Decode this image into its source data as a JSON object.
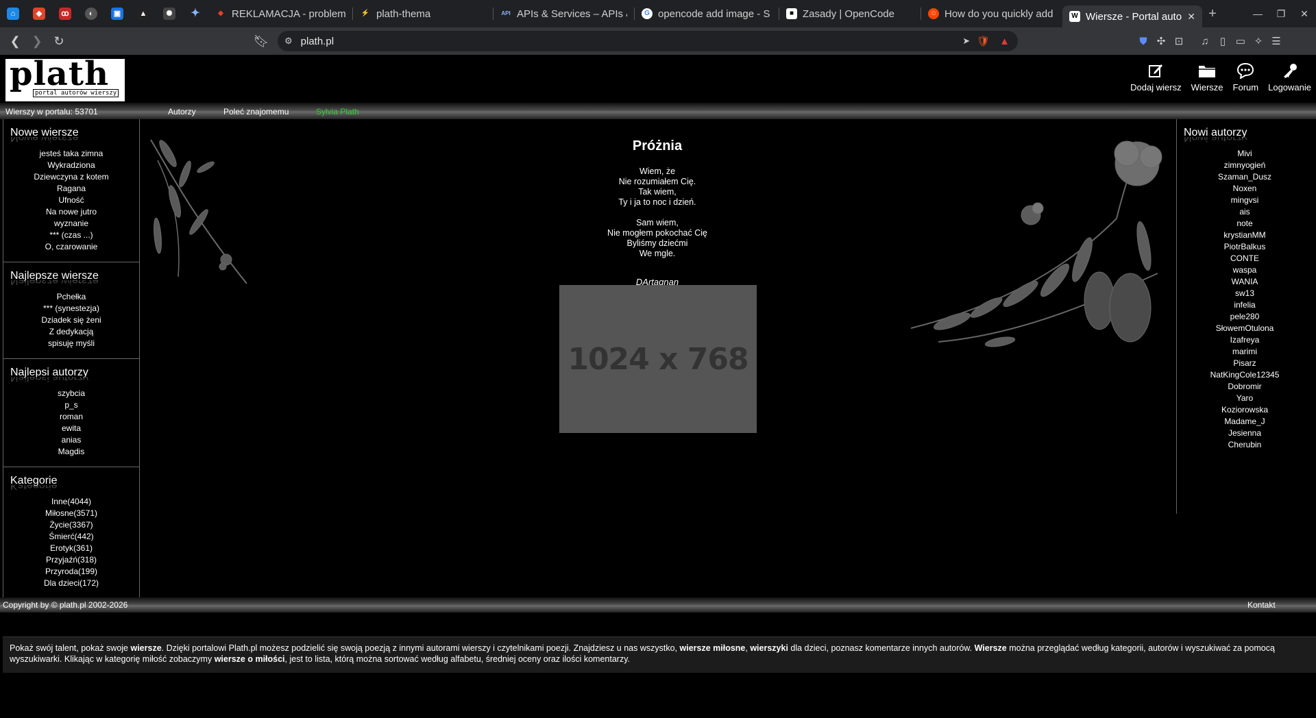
{
  "browser": {
    "tabs": [
      {
        "title": "REKLAMACJA - problem",
        "fav": "gitlab"
      },
      {
        "title": "plath-thema",
        "fav": "figma"
      },
      {
        "title": "APIs & Services – APIs &",
        "fav": "api"
      },
      {
        "title": "opencode add image - S",
        "fav": "google"
      },
      {
        "title": "Zasady | OpenCode",
        "fav": "opencode"
      },
      {
        "title": "How do you quickly add",
        "fav": "reddit"
      },
      {
        "title": "Wiersze - Portal auto",
        "fav": "plath",
        "active": true
      }
    ],
    "address": "plath.pl"
  },
  "site": {
    "logo_big": "plath",
    "logo_small": "portal autorów wierszy",
    "topnav": [
      {
        "label": "Dodaj wiersz",
        "icon": "edit-icon"
      },
      {
        "label": "Wiersze",
        "icon": "folder-icon"
      },
      {
        "label": "Forum",
        "icon": "chat-icon"
      },
      {
        "label": "Logowanie",
        "icon": "key-icon"
      }
    ],
    "subnav": {
      "count": "Wierszy w portalu: 53701",
      "authors": "Autorzy",
      "recommend": "Poleć znajomemu",
      "featured": "Sylvia Plath"
    },
    "new_poems": {
      "title": "Nowe wiersze",
      "items": [
        "jesteś taka zimna",
        "Wykradziona",
        "Dziewczyna z kotem",
        "Ragana",
        "Ufność",
        "Na nowe jutro",
        "wyznanie",
        "*** (czas ...)",
        "O, czarowanie"
      ]
    },
    "best_poems": {
      "title": "Najlepsze wiersze",
      "items": [
        "Pchełka",
        "*** (synestezja)",
        "Dziadek się żeni",
        "Z dedykacją",
        "spisuję myśli"
      ]
    },
    "best_authors": {
      "title": "Najlepsi autorzy",
      "items": [
        "szybcia",
        "p_s",
        "roman",
        "ewita",
        "anias",
        "Magdis"
      ]
    },
    "categories": {
      "title": "Kategorie",
      "items": [
        "Inne(4044)",
        "Miłosne(3571)",
        "Życie(3367)",
        "Śmierć(442)",
        "Erotyk(361)",
        "Przyjaźń(318)",
        "Przyroda(199)",
        "Dla dzieci(172)"
      ]
    },
    "poem": {
      "title": "Próżnia",
      "stanza1": [
        "Wiem, że",
        "Nie rozumiałem Cię.",
        "Tak wiem,",
        "Ty i ja to noc i dzień."
      ],
      "stanza2": [
        "Sam wiem,",
        "Nie mogłem pokochać Cię",
        "Byliśmy dziećmi",
        "We mgle."
      ],
      "author": "DArtagnan",
      "image_placeholder": "1024 x 768"
    },
    "new_authors": {
      "title": "Nowi autorzy",
      "items": [
        "Mivi",
        "zimnyogień",
        "Szaman_Dusz",
        "Noxen",
        "mingvsi",
        "ais",
        "note",
        "krystianMM",
        "PiotrBalkus",
        "CONTE",
        "waspa",
        "WANIA",
        "sw13",
        "infelia",
        "pele280",
        "SłowemOtulona",
        "Izafreya",
        "marimi",
        "Pisarz",
        "NatKingCole12345",
        "Dobromir",
        "Yaro",
        "Koziorowska",
        "Madame_J",
        "Jesienna",
        "Cherubin"
      ]
    },
    "footer": {
      "copyright": "Copyright by © plath.pl 2002-2026",
      "contact": "Kontakt"
    },
    "description": {
      "p1": "Pokaż swój talent, pokaż swoje ",
      "b1": "wiersze",
      "p2": ". Dzięki portalowi Plath.pl możesz podzielić się swoją poezją z innymi autorami wierszy i czytelnikami poezji. Znajdziesz u nas wszystko, ",
      "b2": "wiersze miłosne",
      "p3": ", ",
      "b3": "wierszyki",
      "p4": " dla dzieci, poznasz komentarze innych autorów. ",
      "b4": "Wiersze",
      "p5": " można przeglądać według kategorii, autorów i wyszukiwać za pomocą wyszukiwarki. Klikając w kategorię miłość zobaczymy ",
      "b5": "wiersze o miłości",
      "p6": ", jest to lista, którą można sortować według alfabetu, średniej oceny oraz ilości komentarzy."
    },
    "colors": {
      "featured_link": "#33cc33",
      "background": "#000000"
    }
  }
}
